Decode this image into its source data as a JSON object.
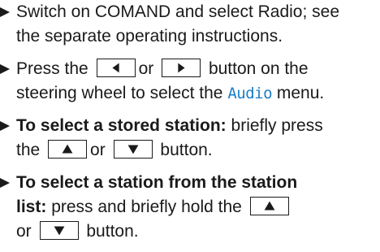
{
  "steps": [
    {
      "line1": "Switch on COMAND and select Radio; see",
      "line2": "the separate operating instructions."
    },
    {
      "line1_prefix": "Press the",
      "or": "or",
      "line1_suffix": "button on the",
      "line2_prefix": "steering wheel to select the",
      "menu_name": "Audio",
      "line2_suffix": "menu."
    },
    {
      "bold": "To select a stored station:",
      "line1_suffix": "briefly press",
      "line2_prefix": "the",
      "or": "or",
      "line2_suffix": "button."
    },
    {
      "bold_line1": "To select a station from the station",
      "bold_line2": "list:",
      "line2_suffix": "press and briefly hold the",
      "line3_prefix": "or",
      "line3_suffix": "button."
    }
  ],
  "icons": {
    "bullet": "triangle-right",
    "key_left": "triangle-left",
    "key_right": "triangle-right",
    "key_up": "triangle-up",
    "key_down": "triangle-down"
  },
  "colors": {
    "text": "#1a1a1a",
    "accent": "#1a7ec8"
  }
}
